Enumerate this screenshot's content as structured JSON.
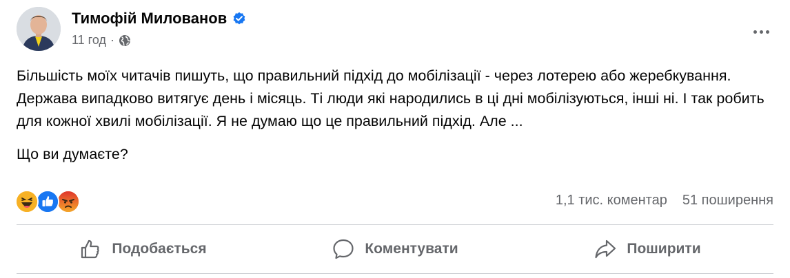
{
  "post": {
    "author": "Тимофій Милованов",
    "time": "11 год",
    "separator": "·",
    "paragraphs": [
      "Більшість моїх читачів пишуть, що правильний підхід до мобілізації - через лотерею або жеребкування. Держава випадково витягує день і місяць. Ті люди які народились в ці дні мобілізуються, інші ні. І так робить для кожної хвилі мобілізації. Я не думаю що це правильний підхід. Але ...",
      "Що ви думаєте?"
    ],
    "icons": {
      "verified": "verified-badge-icon",
      "audience": "globe-icon",
      "more": "more-options-icon"
    },
    "colors": {
      "verified": "#1877f2",
      "like": "#1877f2",
      "haha": "#f7b125",
      "angry": "#e9710f",
      "meta_text": "#65676b"
    }
  },
  "stats": {
    "comments": "1,1 тис. коментар",
    "shares": "51 поширення",
    "reactions": [
      "haha-icon",
      "like-icon",
      "angry-icon"
    ]
  },
  "actions": {
    "like": "Подобається",
    "comment": "Коментувати",
    "share": "Поширити"
  }
}
